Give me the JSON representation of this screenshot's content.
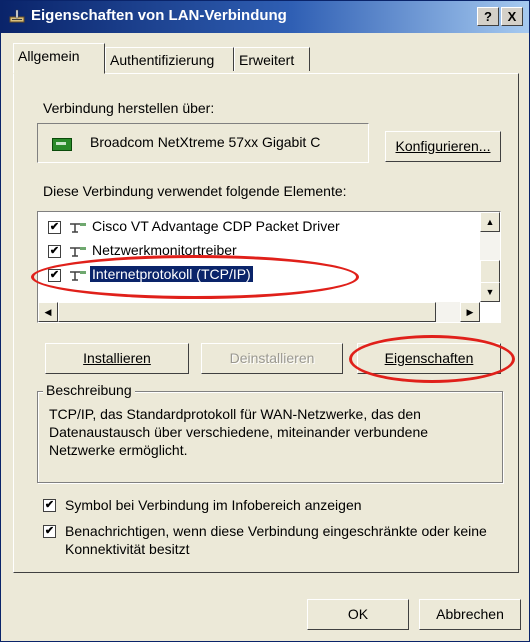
{
  "window": {
    "title": "Eigenschaften von LAN-Verbindung",
    "help_label": "?",
    "close_label": "X"
  },
  "tabs": [
    {
      "label": "Allgemein",
      "active": true
    },
    {
      "label": "Authentifizierung",
      "active": false
    },
    {
      "label": "Erweitert",
      "active": false
    }
  ],
  "general": {
    "connect_via_label": "Verbindung herstellen über:",
    "adapter_name": "Broadcom NetXtreme 57xx Gigabit C",
    "configure_label": "Konfigurieren...",
    "components_label": "Diese Verbindung verwendet folgende Elemente:",
    "components": [
      {
        "label": "Cisco VT Advantage CDP Packet Driver",
        "checked": true,
        "selected": false
      },
      {
        "label": "Netzwerkmonitortreiber",
        "checked": true,
        "selected": false
      },
      {
        "label": "Internetprotokoll (TCP/IP)",
        "checked": true,
        "selected": true
      }
    ],
    "install_label": "Installieren",
    "uninstall_label": "Deinstallieren",
    "properties_label": "Eigenschaften",
    "description_title": "Beschreibung",
    "description_text": "TCP/IP, das Standardprotokoll für WAN-Netzwerke, das den Datenaustausch über verschiedene, miteinander verbundene Netzwerke ermöglicht.",
    "show_icon_label": "Symbol bei Verbindung im Infobereich anzeigen",
    "show_icon_checked": true,
    "notify_label": "Benachrichtigen, wenn diese Verbindung eingeschränkte oder keine Konnektivität besitzt",
    "notify_checked": true
  },
  "footer": {
    "ok_label": "OK",
    "cancel_label": "Abbrechen"
  },
  "colors": {
    "titlebar": "#0a246a",
    "selection": "#0a246a",
    "annotation": "#e0201a",
    "face": "#ece9d8"
  }
}
